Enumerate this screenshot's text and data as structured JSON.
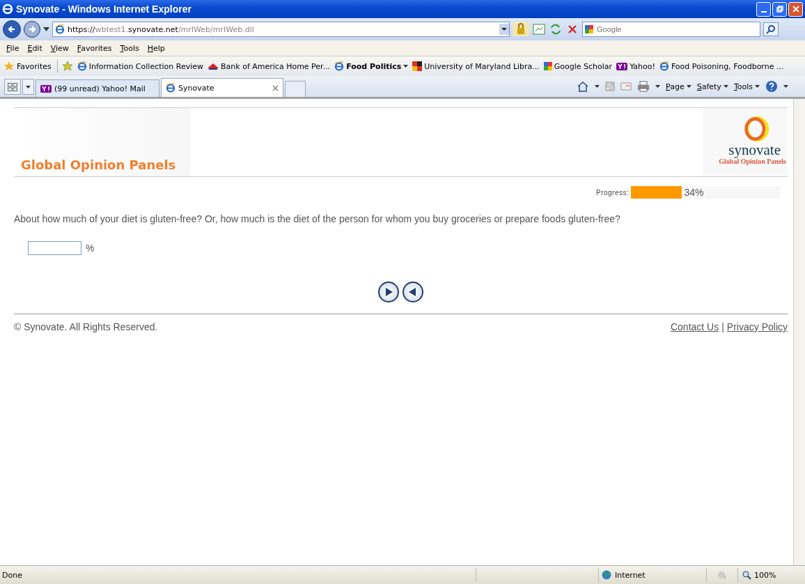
{
  "window": {
    "title": "Synovate - Windows Internet Explorer"
  },
  "address_bar": {
    "scheme": "https://",
    "host_prefix": "wbtest1.",
    "host": "synovate.net",
    "path": "/mrIWeb/mrIWeb.dll"
  },
  "search": {
    "placeholder": "Google"
  },
  "menu": [
    "File",
    "Edit",
    "View",
    "Favorites",
    "Tools",
    "Help"
  ],
  "favorites_bar": {
    "label": "Favorites",
    "items": [
      {
        "label": "Information Collection Review",
        "kind": "page",
        "bold": false,
        "dropdown": false
      },
      {
        "label": "Bank of America  Home  Per...",
        "kind": "bank",
        "bold": false,
        "dropdown": false
      },
      {
        "label": "Food Politics",
        "kind": "page",
        "bold": true,
        "dropdown": true
      },
      {
        "label": "University of Maryland Libra...",
        "kind": "crest",
        "bold": false,
        "dropdown": false
      },
      {
        "label": "Google Scholar",
        "kind": "google",
        "bold": false,
        "dropdown": false
      },
      {
        "label": "Yahoo!",
        "kind": "yahoo",
        "bold": false,
        "dropdown": false
      },
      {
        "label": "Food Poisoning, Foodborne ...",
        "kind": "page",
        "bold": false,
        "dropdown": false
      }
    ]
  },
  "tabs": [
    {
      "label": "(99 unread) Yahoo! Mail",
      "kind": "yahoo",
      "selected": false
    },
    {
      "label": "Synovate",
      "kind": "page",
      "selected": true
    }
  ],
  "command_bar": [
    "Page",
    "Safety",
    "Tools"
  ],
  "page": {
    "brand_title": "Global Opinion Panels",
    "logo_word": "synovate",
    "logo_tagline": "Global Opinion Panels",
    "progress": {
      "label": "Progress:",
      "level": 0.34,
      "reading": "34%"
    },
    "question": "About how much of your diet is gluten-free? Or, how much is the diet of the person for whom you buy groceries or prepare foods gluten-free?",
    "answer": {
      "unit": "%"
    },
    "copyright": "© Synovate. All Rights Reserved.",
    "footer_links": [
      "Contact Us",
      "Privacy Policy"
    ],
    "link_separator": "|"
  },
  "status_bar": {
    "text": "Done",
    "zone": "Internet",
    "zoom": "100%"
  }
}
